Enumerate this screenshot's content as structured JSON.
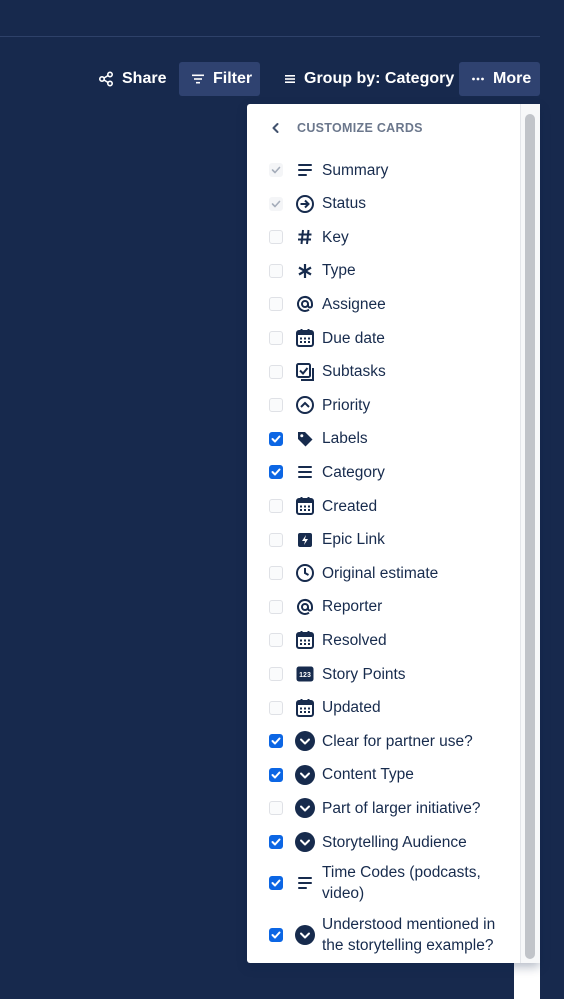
{
  "toolbar": {
    "share_label": "Share",
    "share_icon": "share-icon",
    "filter_label": "Filter",
    "filter_icon": "filter-icon",
    "group_label": "Group by: Category",
    "group_icon": "list-icon",
    "more_label": "More",
    "more_icon": "ellipsis-icon"
  },
  "panel": {
    "title": "CUSTOMIZE CARDS",
    "back_icon": "chevron-left-icon",
    "items": [
      {
        "label": "Summary",
        "state": "disabled",
        "icon": "text-lines-icon"
      },
      {
        "label": "Status",
        "state": "disabled",
        "icon": "arrow-circle-icon"
      },
      {
        "label": "Key",
        "state": "unchecked",
        "icon": "hash-icon"
      },
      {
        "label": "Type",
        "state": "unchecked",
        "icon": "asterisk-icon"
      },
      {
        "label": "Assignee",
        "state": "unchecked",
        "icon": "at-sign-icon"
      },
      {
        "label": "Due date",
        "state": "unchecked",
        "icon": "calendar-icon"
      },
      {
        "label": "Subtasks",
        "state": "unchecked",
        "icon": "subtasks-icon"
      },
      {
        "label": "Priority",
        "state": "unchecked",
        "icon": "priority-icon"
      },
      {
        "label": "Labels",
        "state": "checked",
        "icon": "tag-icon"
      },
      {
        "label": "Category",
        "state": "checked",
        "icon": "list-icon"
      },
      {
        "label": "Created",
        "state": "unchecked",
        "icon": "calendar-icon"
      },
      {
        "label": "Epic Link",
        "state": "unchecked",
        "icon": "epic-icon"
      },
      {
        "label": "Original estimate",
        "state": "unchecked",
        "icon": "clock-icon"
      },
      {
        "label": "Reporter",
        "state": "unchecked",
        "icon": "at-sign-icon"
      },
      {
        "label": "Resolved",
        "state": "unchecked",
        "icon": "calendar-icon"
      },
      {
        "label": "Story Points",
        "state": "unchecked",
        "icon": "number-icon",
        "icon_text": "123"
      },
      {
        "label": "Updated",
        "state": "unchecked",
        "icon": "calendar-icon"
      },
      {
        "label": "Clear for partner use?",
        "state": "checked",
        "icon": "dropdown-circle-icon"
      },
      {
        "label": "Content Type",
        "state": "checked",
        "icon": "dropdown-circle-icon"
      },
      {
        "label": "Part of larger initiative?",
        "state": "unchecked",
        "icon": "dropdown-circle-icon"
      },
      {
        "label": "Storytelling Audience",
        "state": "checked",
        "icon": "dropdown-circle-icon"
      },
      {
        "label": "Time Codes (podcasts, video)",
        "state": "checked",
        "icon": "text-lines-icon"
      },
      {
        "label": "Understood mentioned in the storytelling example?",
        "state": "checked",
        "icon": "dropdown-circle-icon"
      }
    ]
  },
  "colors": {
    "background": "#17294d",
    "accent": "#0c66e4",
    "text": "#172b4d",
    "header_text": "#6b778c"
  }
}
